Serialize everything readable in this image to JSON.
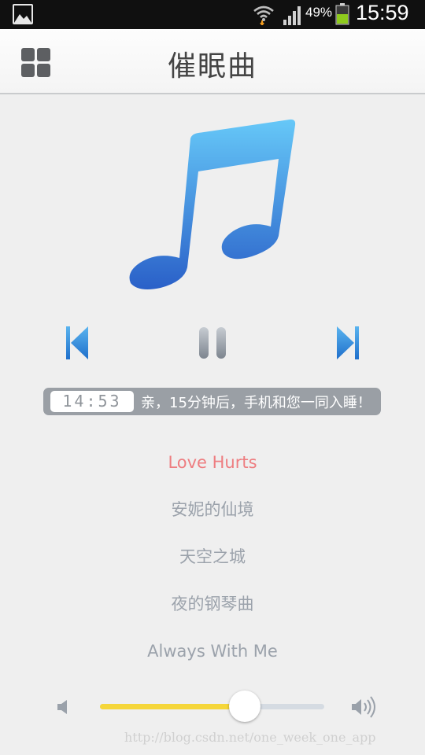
{
  "status_bar": {
    "battery_percent": "49%",
    "time": "15:59",
    "icons": [
      "gallery-icon",
      "wifi-icon",
      "signal-icon",
      "battery-icon"
    ]
  },
  "header": {
    "title": "催眠曲",
    "menu_icon": "grid-icon"
  },
  "artwork": {
    "icon": "music-note-icon",
    "colors": {
      "top": "#66c8f8",
      "bottom": "#2a60c8"
    }
  },
  "controls": {
    "previous_icon": "skip-previous-icon",
    "pause_icon": "pause-icon",
    "next_icon": "skip-next-icon",
    "accent": "#2f86de"
  },
  "timer": {
    "display": "14:53",
    "message": "亲，15分钟后，手机和您一同入睡！"
  },
  "playlist": {
    "active_color": "#ee7d80",
    "items": [
      {
        "title": "Love Hurts",
        "active": true
      },
      {
        "title": "安妮的仙境",
        "active": false
      },
      {
        "title": "天空之城",
        "active": false
      },
      {
        "title": "夜的钢琴曲",
        "active": false
      },
      {
        "title": "Always With Me",
        "active": false
      }
    ]
  },
  "volume": {
    "level": 0.645,
    "fill_color": "#f5d63a",
    "low_icon": "volume-low-icon",
    "high_icon": "volume-high-icon"
  },
  "watermark": "http://blog.csdn.net/one_week_one_app"
}
